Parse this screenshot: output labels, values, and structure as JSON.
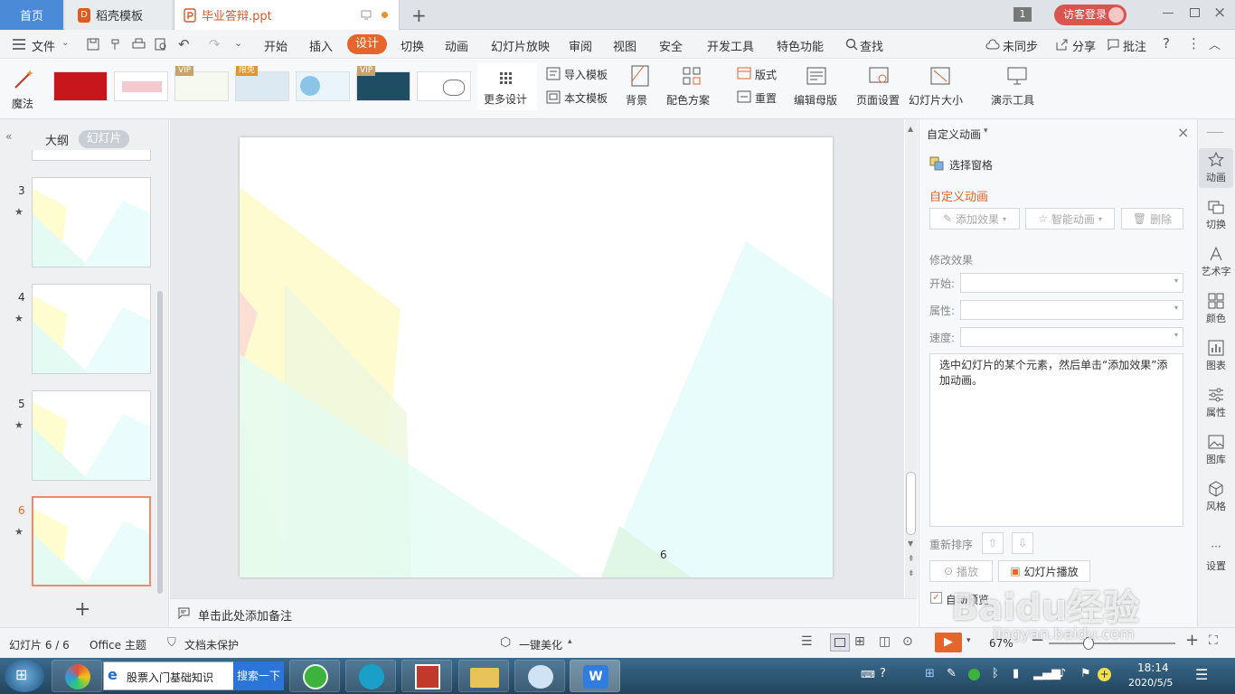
{
  "tabs": {
    "home": "首页",
    "template": "稻壳模板",
    "doc": "毕业答辩.ppt",
    "count_badge": "1",
    "login": "访客登录"
  },
  "menu": {
    "file": "文件",
    "items": [
      "开始",
      "插入",
      "设计",
      "切换",
      "动画",
      "幻灯片放映",
      "审阅",
      "视图",
      "安全",
      "开发工具",
      "特色功能"
    ],
    "search": "查找",
    "sync": "未同步",
    "share": "分享",
    "comment": "批注"
  },
  "ribbon": {
    "magic": "魔法",
    "badges": {
      "vip": "VIP",
      "free": "限免"
    },
    "more_design": "更多设计",
    "import_tpl": "导入模板",
    "this_tpl": "本文模板",
    "background": "背景",
    "color_scheme": "配色方案",
    "layout": "版式",
    "reset": "重置",
    "edit_master": "编辑母版",
    "page_setup": "页面设置",
    "slide_size": "幻灯片大小",
    "present_tools": "演示工具"
  },
  "left": {
    "outline": "大纲",
    "slides": "幻灯片",
    "thumbs": [
      {
        "num": "3"
      },
      {
        "num": "4"
      },
      {
        "num": "5"
      },
      {
        "num": "6"
      }
    ],
    "star": "★"
  },
  "slide": {
    "page_number": "6"
  },
  "notes": {
    "placeholder": "单击此处添加备注"
  },
  "anim_panel": {
    "title": "自定义动画",
    "select_pane": "选择窗格",
    "section_title": "自定义动画",
    "add_effect": "添加效果",
    "smart_anim": "智能动画",
    "delete": "删除",
    "modify": "修改效果",
    "start": "开始:",
    "property": "属性:",
    "speed": "速度:",
    "hint": "选中幻灯片的某个元素，然后单击“添加效果”添加动画。",
    "reorder": "重新排序",
    "play": "播放",
    "slideshow": "幻灯片播放",
    "autopreview": "自动预览"
  },
  "sidebar": [
    "动画",
    "切换",
    "艺术字",
    "颜色",
    "图表",
    "属性",
    "图库",
    "风格",
    "设置"
  ],
  "status": {
    "slide_info": "幻灯片 6 / 6",
    "theme": "Office 主题",
    "protect": "文档未保护",
    "beautify": "一键美化",
    "zoom": "67%"
  },
  "taskbar": {
    "ie_title": "股票入门基础知识",
    "search_btn": "搜索一下",
    "time": "18:14",
    "date": "2020/5/5"
  },
  "watermark": {
    "text": "Baidu经验",
    "sub": "jingyan.baidu.com"
  },
  "colors": {
    "accent": "#e5652b",
    "tab_blue": "#4a8ad6",
    "selected_thumb": "#f08a6a"
  }
}
